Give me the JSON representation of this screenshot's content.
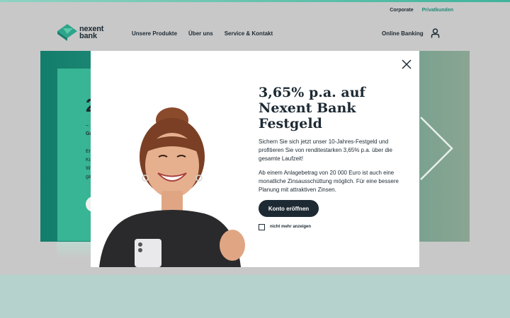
{
  "header": {
    "utility_links": [
      "Corporate",
      "Privatkunden"
    ],
    "logo_line1": "nexent",
    "logo_line2": "bank",
    "nav": [
      "Unsere Produkte",
      "Über uns",
      "Service & Kontakt"
    ],
    "online_banking": "Online Banking"
  },
  "hero": {
    "headline": "2",
    "line1": "–",
    "line2": "Ga",
    "para": [
      "Er",
      "Ko",
      "W",
      "ga"
    ]
  },
  "modal": {
    "title": "3,65% p.a. auf Nexent Bank Festgeld",
    "para1": "Sichern Sie sich jetzt unser 10-Jahres-Festgeld und profitieren Sie von renditestarken 3,65% p.a. über die gesamte Laufzeit!",
    "para2": "Ab einem Anlagebetrag von 20 000 Euro ist auch eine monatliche Zinsausschüttung möglich. Für eine bessere Planung mit attraktiven Zinsen.",
    "cta": "Konto eröffnen",
    "checkbox_label": "nicht mehr anzeigen"
  },
  "colors": {
    "brand_teal": "#1f8a75",
    "dark_navy": "#1d2a33",
    "hero_green": "#37b594"
  }
}
